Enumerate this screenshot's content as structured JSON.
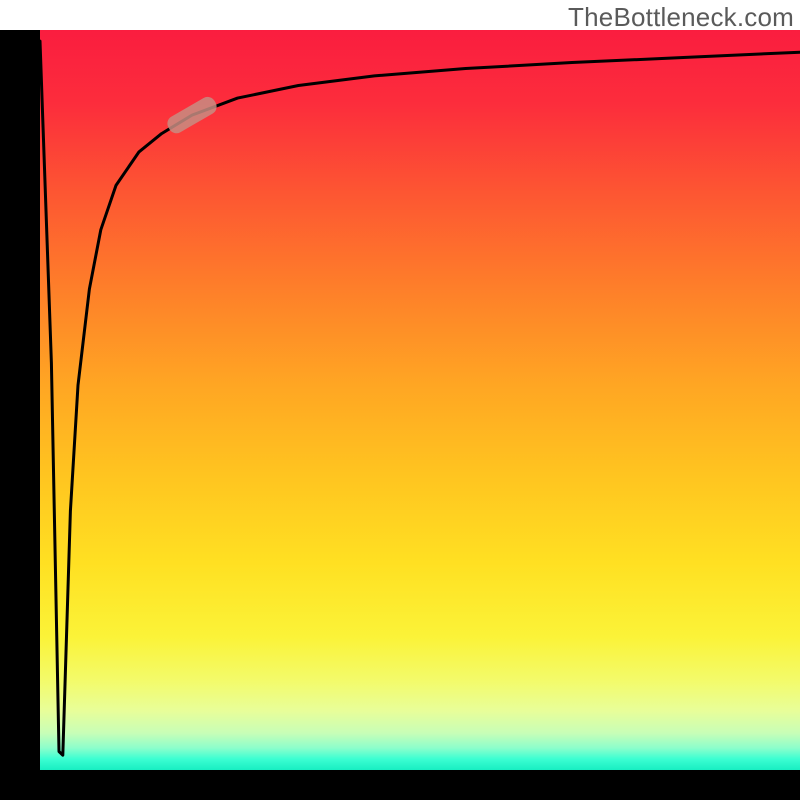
{
  "watermark": "TheBottleneck.com",
  "chart_data": {
    "type": "line",
    "title": "",
    "xlabel": "",
    "ylabel": "",
    "xlim": [
      0,
      100
    ],
    "ylim": [
      0,
      100
    ],
    "grid": false,
    "series": [
      {
        "name": "bottleneck-curve",
        "x": [
          0.0,
          1.5,
          2.5,
          3.0,
          4.0,
          5.0,
          6.5,
          8.0,
          10.0,
          13.0,
          16.0,
          20.0,
          26.0,
          34.0,
          44.0,
          56.0,
          70.0,
          85.0,
          100.0
        ],
        "y": [
          98.5,
          55.0,
          2.5,
          2.0,
          35.0,
          52.0,
          65.0,
          73.0,
          79.0,
          83.5,
          86.0,
          88.5,
          90.8,
          92.5,
          93.8,
          94.8,
          95.6,
          96.3,
          97.0
        ]
      }
    ],
    "annotations": [
      {
        "name": "highlight-segment",
        "x": 20,
        "y": 88.5,
        "angle_deg": 30,
        "length": 7,
        "color": "#c78d83"
      }
    ],
    "background_gradient": {
      "top": "#fa1d3f",
      "bottom": "#18eec2"
    }
  }
}
